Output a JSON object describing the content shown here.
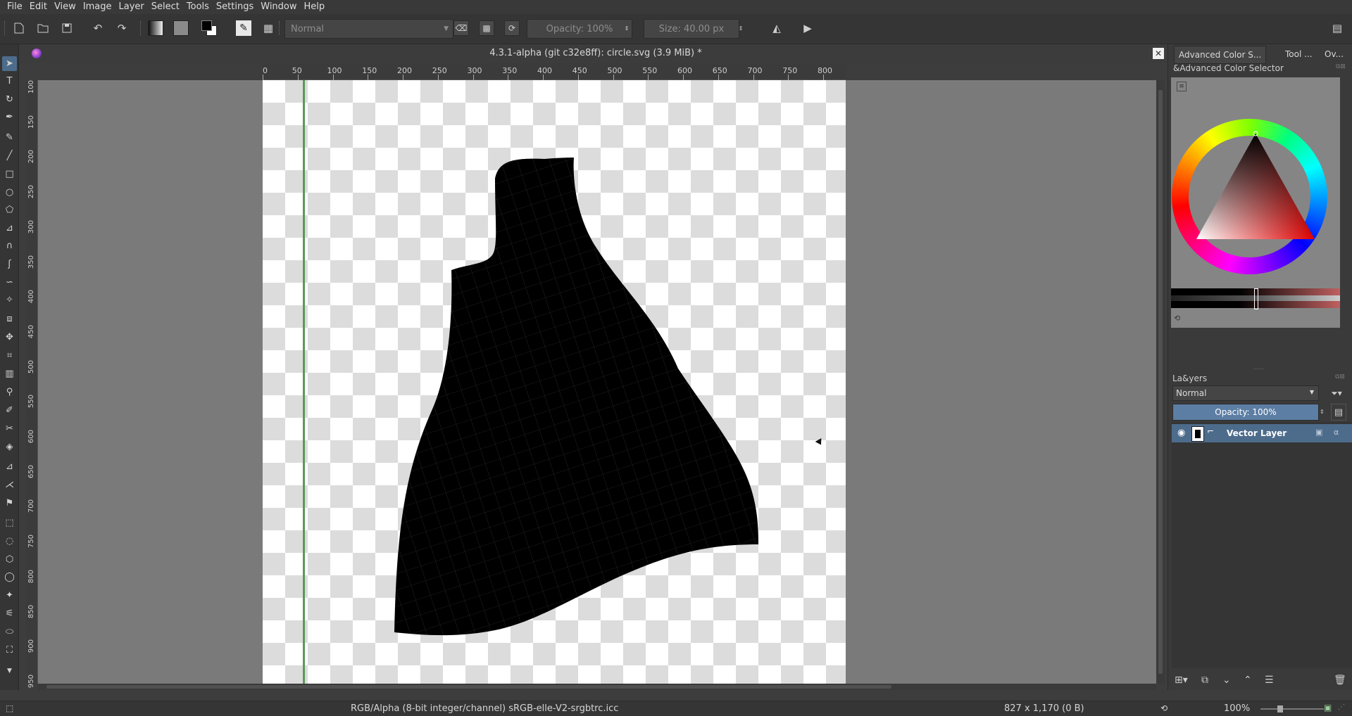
{
  "menu": [
    "File",
    "Edit",
    "View",
    "Image",
    "Layer",
    "Select",
    "Tools",
    "Settings",
    "Window",
    "Help"
  ],
  "tool_options": {
    "blend_mode": "Normal",
    "opacity": "Opacity: 100%",
    "size": "Size: 40.00 px"
  },
  "document": {
    "title": "4.3.1-alpha (git c32e8ff): circle.svg (3.9 MiB) *",
    "h_ruler_ticks": [
      "0",
      "50",
      "100",
      "150",
      "200",
      "250",
      "300",
      "350",
      "400",
      "450",
      "500",
      "550",
      "600",
      "650",
      "700",
      "750",
      "800"
    ],
    "v_ruler_ticks": [
      "100",
      "150",
      "200",
      "250",
      "300",
      "350",
      "400",
      "450",
      "500",
      "550",
      "600",
      "650",
      "700",
      "750",
      "800",
      "850",
      "900",
      "950"
    ]
  },
  "dock": {
    "tabs": [
      "Advanced Color S...",
      "Tool ...",
      "Ov..."
    ],
    "color_panel_title": "&Advanced Color Selector",
    "layers_title": "La&yers",
    "layer_mode": "Normal",
    "layer_opacity": "Opacity:  100%",
    "layers": [
      {
        "name": "Vector Layer",
        "selected": true,
        "visible": true
      }
    ]
  },
  "status": {
    "color_space": "RGB/Alpha (8-bit integer/channel)  sRGB-elle-V2-srgbtrc.icc",
    "image_size": "827 x 1,170 (0 B)",
    "zoom": "100%"
  },
  "colors": {
    "accent": "#4d6c8c",
    "foreground": "#000000",
    "background": "#ffffff"
  }
}
